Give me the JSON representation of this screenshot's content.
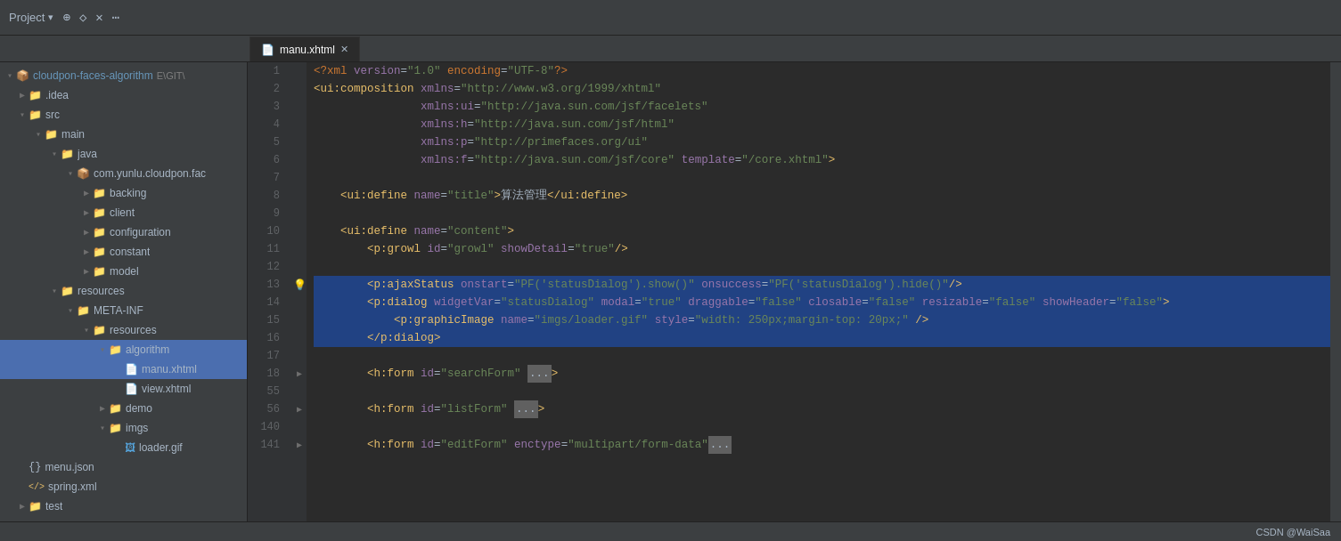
{
  "titleBar": {
    "project_label": "Project",
    "chevron_icon": "▾",
    "icons": [
      "⊕",
      "◇",
      "✕",
      "⋯"
    ]
  },
  "tabs": [
    {
      "name": "manu.xhtml",
      "active": true,
      "icon": "📄",
      "closable": true
    }
  ],
  "sidebar": {
    "root": {
      "label": "cloudpon-faces-algorithm",
      "badge": "E:\\GIT\\",
      "children": [
        {
          "label": ".idea",
          "type": "folder",
          "depth": 1,
          "expanded": false
        },
        {
          "label": "src",
          "type": "folder",
          "depth": 1,
          "expanded": true,
          "children": [
            {
              "label": "main",
              "type": "folder",
              "depth": 2,
              "expanded": true,
              "children": [
                {
                  "label": "java",
                  "type": "folder",
                  "depth": 3,
                  "expanded": true,
                  "children": [
                    {
                      "label": "com.yunlu.cloudpon.fac",
                      "type": "package",
                      "depth": 4,
                      "expanded": true,
                      "children": [
                        {
                          "label": "backing",
                          "type": "folder",
                          "depth": 5,
                          "expanded": false
                        },
                        {
                          "label": "client",
                          "type": "folder",
                          "depth": 5,
                          "expanded": false
                        },
                        {
                          "label": "configuration",
                          "type": "folder",
                          "depth": 5,
                          "expanded": false
                        },
                        {
                          "label": "constant",
                          "type": "folder",
                          "depth": 5,
                          "expanded": false
                        },
                        {
                          "label": "model",
                          "type": "folder",
                          "depth": 5,
                          "expanded": false
                        }
                      ]
                    }
                  ]
                },
                {
                  "label": "resources",
                  "type": "folder",
                  "depth": 3,
                  "expanded": true,
                  "children": [
                    {
                      "label": "META-INF",
                      "type": "folder",
                      "depth": 4,
                      "expanded": true,
                      "children": [
                        {
                          "label": "resources",
                          "type": "folder",
                          "depth": 5,
                          "expanded": true,
                          "children": [
                            {
                              "label": "algorithm",
                              "type": "folder",
                              "depth": 6,
                              "expanded": true,
                              "selected": false,
                              "children": [
                                {
                                  "label": "manu.xhtml",
                                  "type": "xhtml",
                                  "depth": 7,
                                  "selected": true
                                },
                                {
                                  "label": "view.xhtml",
                                  "type": "xhtml",
                                  "depth": 7
                                }
                              ]
                            },
                            {
                              "label": "demo",
                              "type": "folder",
                              "depth": 6
                            },
                            {
                              "label": "imgs",
                              "type": "folder",
                              "depth": 6,
                              "expanded": true,
                              "children": [
                                {
                                  "label": "loader.gif",
                                  "type": "gif",
                                  "depth": 7
                                }
                              ]
                            }
                          ]
                        }
                      ]
                    }
                  ]
                }
              ]
            }
          ]
        },
        {
          "label": "menu.json",
          "type": "json",
          "depth": 2
        },
        {
          "label": "spring.xml",
          "type": "xml",
          "depth": 2
        }
      ]
    },
    "test": {
      "label": "test",
      "type": "folder",
      "depth": 1
    }
  },
  "editor": {
    "filename": "manu.xhtml",
    "lines": [
      {
        "num": 1,
        "code": "<?xml version=\"1.0\" encoding=\"UTF-8\"?>"
      },
      {
        "num": 2,
        "code": "<ui:composition xmlns=\"http://www.w3.org/1999/xhtml\""
      },
      {
        "num": 3,
        "code": "                xmlns:ui=\"http://java.sun.com/jsf/facelets\""
      },
      {
        "num": 4,
        "code": "                xmlns:h=\"http://java.sun.com/jsf/html\""
      },
      {
        "num": 5,
        "code": "                xmlns:p=\"http://primefaces.org/ui\""
      },
      {
        "num": 6,
        "code": "                xmlns:f=\"http://java.sun.com/jsf/core\" template=\"/core.xhtml\">"
      },
      {
        "num": 7,
        "code": ""
      },
      {
        "num": 8,
        "code": "    <ui:define name=\"title\">算法管理</ui:define>"
      },
      {
        "num": 9,
        "code": ""
      },
      {
        "num": 10,
        "code": "    <ui:define name=\"content\">"
      },
      {
        "num": 11,
        "code": "        <p:growl id=\"growl\" showDetail=\"true\"/>"
      },
      {
        "num": 12,
        "code": ""
      },
      {
        "num": 13,
        "code": "        <p:ajaxStatus onstart=\"PF('statusDialog').show()\" onsuccess=\"PF('statusDialog').hide()\"/>",
        "selected": true,
        "has_bulb": true
      },
      {
        "num": 14,
        "code": "        <p:dialog widgetVar=\"statusDialog\" modal=\"true\" draggable=\"false\" closable=\"false\" resizable=\"false\" showHeader=\"false\">",
        "selected": true
      },
      {
        "num": 15,
        "code": "            <p:graphicImage name=\"imgs/loader.gif\" style=\"width: 250px;margin-top: 20px;\" />",
        "selected": true
      },
      {
        "num": 16,
        "code": "        </p:dialog>",
        "selected": true
      },
      {
        "num": 17,
        "code": ""
      },
      {
        "num": 18,
        "code": "        <h:form id=\"searchForm\"",
        "has_arrow": true
      },
      {
        "num": 55,
        "code": ""
      },
      {
        "num": 56,
        "code": "        <h:form id=\"listForm\"",
        "has_arrow": true
      },
      {
        "num": 140,
        "code": ""
      },
      {
        "num": 141,
        "code": "        <h:form id=\"editForm\" enctype=\"multipart/form-data\"",
        "has_arrow": true
      }
    ]
  },
  "statusBar": {
    "credit": "CSDN @WaiSaa"
  }
}
